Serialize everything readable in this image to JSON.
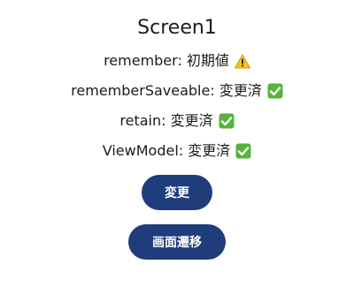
{
  "screen": {
    "title": "Screen1"
  },
  "states": [
    {
      "label": "remember: 初期値",
      "status_icon": "warning-icon"
    },
    {
      "label": "rememberSaveable: 変更済",
      "status_icon": "check-icon"
    },
    {
      "label": "retain: 変更済",
      "status_icon": "check-icon"
    },
    {
      "label": "ViewModel: 変更済",
      "status_icon": "check-icon"
    }
  ],
  "buttons": {
    "change_label": "変更",
    "navigate_label": "画面遷移"
  },
  "colors": {
    "button_bg": "#1f3d7a",
    "check_green": "#57b33a",
    "warning_yellow": "#f5c518"
  }
}
